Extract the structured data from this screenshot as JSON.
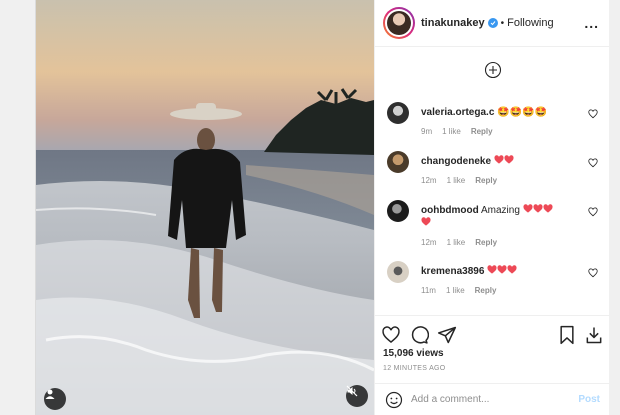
{
  "header": {
    "username": "tinakunakey",
    "separator": "•",
    "follow_status": "Following",
    "more_label": "..."
  },
  "comments": [
    {
      "username": "valeria.ortega.c",
      "text": "",
      "emojis": "🤩🤩🤩🤩",
      "time": "9m",
      "likes": "1 like",
      "reply": "Reply"
    },
    {
      "username": "changodeneke",
      "text": "",
      "emojis": "",
      "hearts": 2,
      "time": "12m",
      "likes": "1 like",
      "reply": "Reply"
    },
    {
      "username": "oohbdmood",
      "text": "Amazing",
      "emojis": "",
      "hearts": 4,
      "time": "12m",
      "likes": "1 like",
      "reply": "Reply"
    },
    {
      "username": "kremena3896",
      "text": "",
      "emojis": "",
      "hearts": 3,
      "time": "11m",
      "likes": "1 like",
      "reply": "Reply"
    }
  ],
  "stats": {
    "views": "15,096 views",
    "posted": "12 MINUTES AGO"
  },
  "composer": {
    "placeholder": "Add a comment...",
    "post_label": "Post"
  },
  "icons": {
    "more_comments": "plus-circle-icon",
    "like": "heart-icon",
    "comment": "comment-icon",
    "share": "paper-plane-icon",
    "save": "bookmark-icon",
    "emoji": "smiley-icon",
    "user_tag": "person-icon",
    "mute": "speaker-muted-icon"
  },
  "colors": {
    "heart_red": "#ed4956",
    "verified_blue": "#3897f0",
    "muted_text": "#8e8e8e",
    "post_disabled": "#b3dbff"
  }
}
